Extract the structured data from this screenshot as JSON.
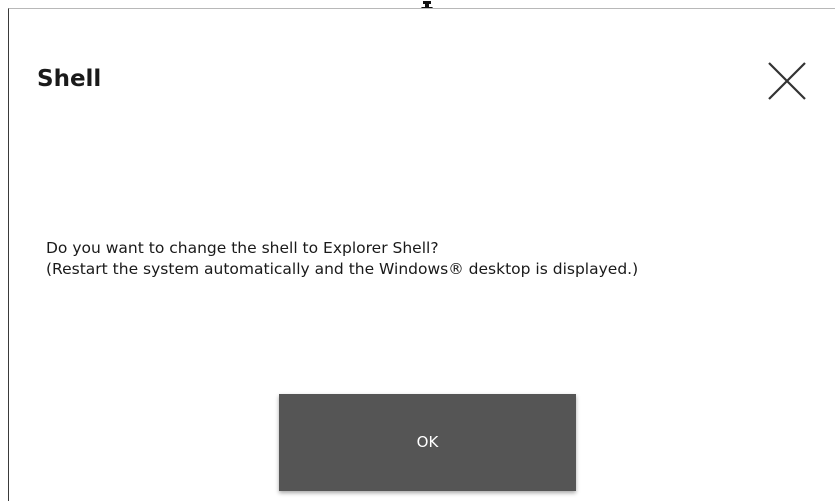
{
  "dialog": {
    "title": "Shell",
    "close_icon": "close-icon",
    "message_line1": "Do you want to change the shell to Explorer Shell?",
    "message_line2": "(Restart the system automatically and the Windows® desktop is displayed.)",
    "ok_label": "OK"
  },
  "cursor": {
    "icon": "arrow-cursor-icon"
  },
  "colors": {
    "ok_button_bg": "#555555",
    "ok_button_text": "#ffffff",
    "text": "#1a1a1a",
    "background": "#ffffff"
  }
}
